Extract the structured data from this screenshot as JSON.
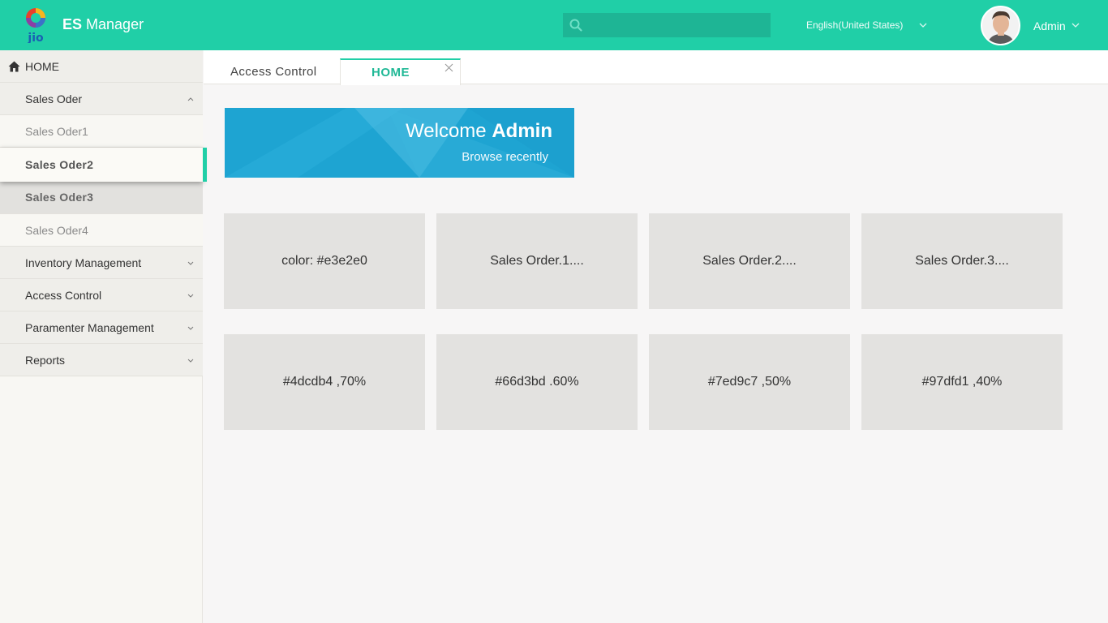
{
  "header": {
    "app_name_bold": "ES",
    "app_name_rest": "Manager",
    "search": {
      "placeholder": ""
    },
    "language": "English(United States)",
    "user": "Admin",
    "colors": {
      "bar": "#20cfa7",
      "search": "#1eb595"
    }
  },
  "sidebar": {
    "home_label": "HOME",
    "items": [
      {
        "label": "Sales Oder",
        "icon": "chevron-up-icon"
      },
      {
        "label": "Sales Oder1"
      },
      {
        "label": "Sales Oder2"
      },
      {
        "label": "Sales Oder3"
      },
      {
        "label": "Sales Oder4"
      },
      {
        "label": "Inventory Management",
        "icon": "chevron-down-icon"
      },
      {
        "label": "Access Control",
        "icon": "chevron-down-icon"
      },
      {
        "label": "Paramenter Management",
        "icon": "chevron-down-icon"
      },
      {
        "label": "Reports",
        "icon": "chevron-down-icon"
      }
    ]
  },
  "tabs": [
    {
      "label": "Access Control"
    },
    {
      "label": "HOME"
    }
  ],
  "banner": {
    "welcome": "Welcome",
    "user": "Admin",
    "subtitle": "Browse recently"
  },
  "cards": [
    "color: #e3e2e0",
    "Sales Order.1....",
    "Sales Order.2....",
    "Sales Order.3....",
    "#4dcdb4 ,70%",
    "#66d3bd .60%",
    "#7ed9c7 ,50%",
    "#97dfd1 ,40%"
  ]
}
